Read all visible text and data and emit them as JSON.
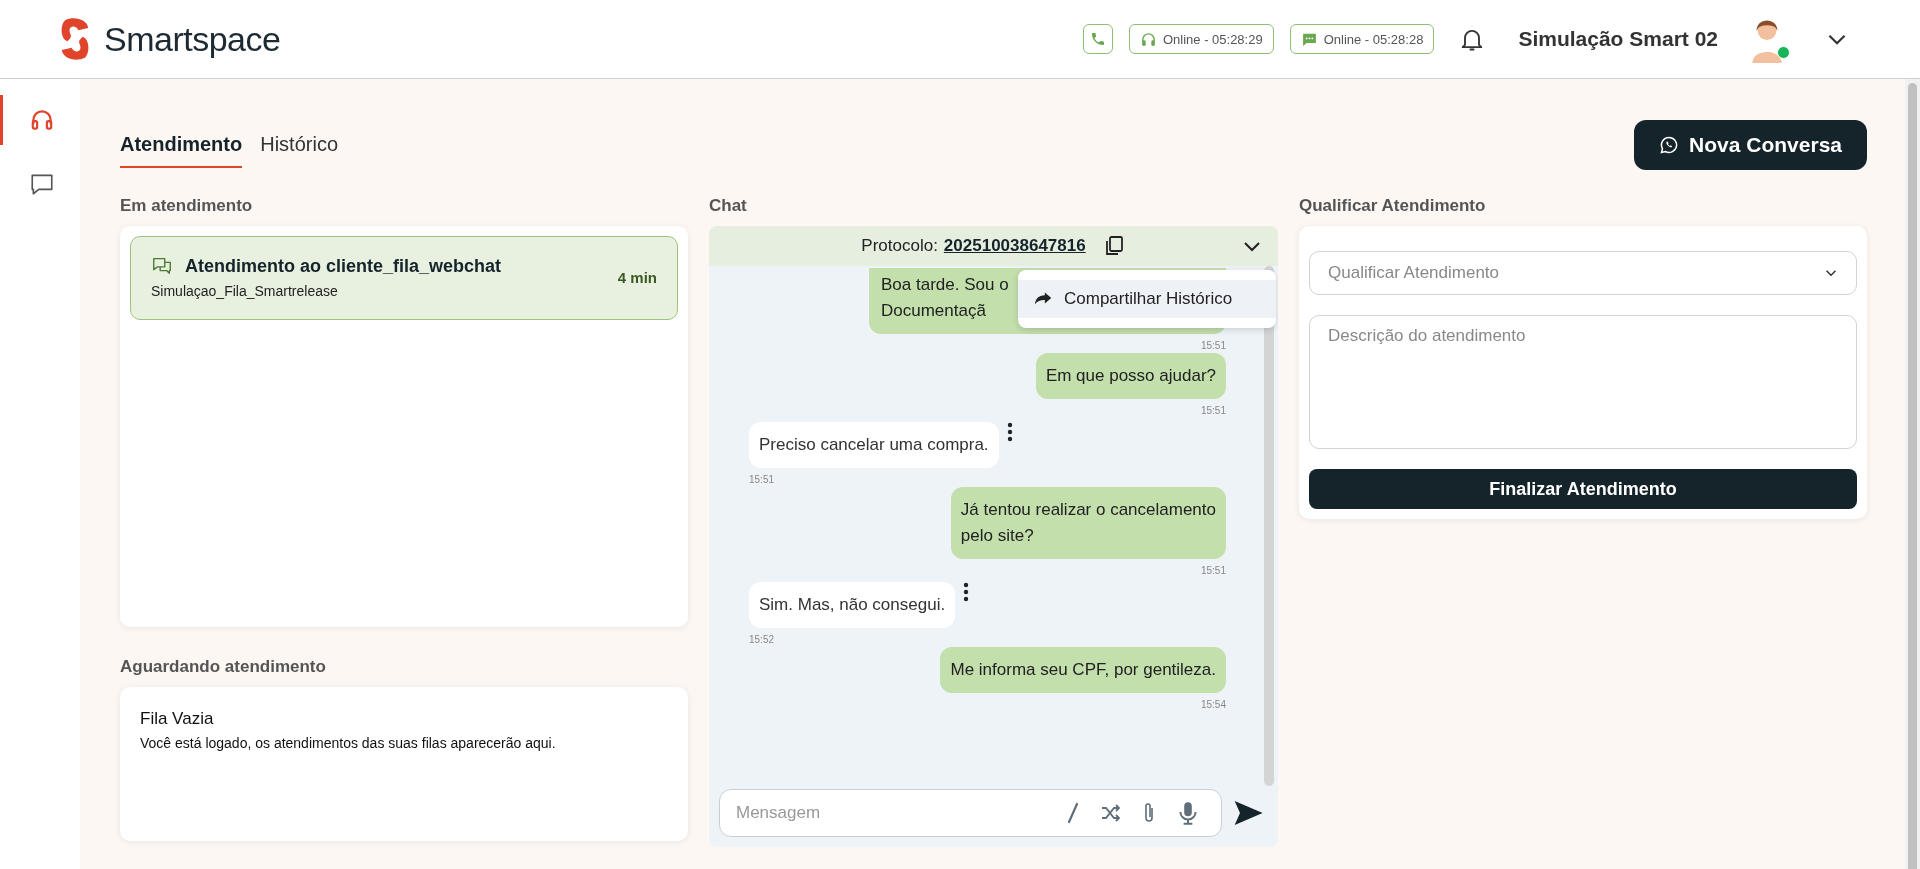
{
  "brand": {
    "name": "Smartspace"
  },
  "header": {
    "statuses": [
      {
        "kind": "phone"
      },
      {
        "kind": "voice",
        "label": "Online - 05:28:29"
      },
      {
        "kind": "chat",
        "label": "Online - 05:28:28"
      }
    ],
    "user": {
      "name": "Simulação Smart 02",
      "online": true
    }
  },
  "sidebar": {
    "items": [
      {
        "kind": "headset",
        "selected": true
      },
      {
        "kind": "chat",
        "selected": false
      }
    ]
  },
  "tabs": [
    {
      "label": "Atendimento",
      "selected": true
    },
    {
      "label": "Histórico",
      "selected": false
    }
  ],
  "new_button": {
    "label": "Nova Conversa"
  },
  "in_service": {
    "title": "Em atendimento",
    "items": [
      {
        "title": "Atendimento ao cliente_fila_webchat",
        "queue": "Simulaçao_Fila_Smartrelease",
        "time": "4 min",
        "selected": true
      }
    ]
  },
  "waiting": {
    "title": "Aguardando atendimento",
    "empty_title": "Fila Vazia",
    "empty_text": "Você está logado, os atendimentos das suas filas aparecerão aqui."
  },
  "chat": {
    "title": "Chat",
    "protocol_label": "Protocolo:",
    "protocol": "202510038647816",
    "menu": [
      {
        "label": "Compartilhar Histórico"
      }
    ],
    "messages": [
      {
        "kind": "agent",
        "text": "Boa tarde. Sou o\nDocumentaçã",
        "time": "15:51",
        "clipped": true
      },
      {
        "kind": "agent",
        "text": "Em que posso ajudar?",
        "time": "15:51",
        "clipped": false
      },
      {
        "kind": "client",
        "text": "Preciso cancelar uma compra.",
        "time": "15:51",
        "clipped": false
      },
      {
        "kind": "agent",
        "text": "Já tentou realizar o cancelamento\npelo site?",
        "time": "15:51",
        "clipped": false
      },
      {
        "kind": "client",
        "text": "Sim. Mas, não consegui.",
        "time": "15:52",
        "clipped": false
      },
      {
        "kind": "agent",
        "text": "Me informa seu CPF, por gentileza.",
        "time": "15:54",
        "clipped": false
      }
    ],
    "input": {
      "placeholder": "Mensagem"
    }
  },
  "qualify": {
    "title": "Qualificar Atendimento",
    "select_placeholder": "Qualificar Atendimento",
    "description_placeholder": "Descrição do atendimento",
    "button": "Finalizar Atendimento"
  }
}
